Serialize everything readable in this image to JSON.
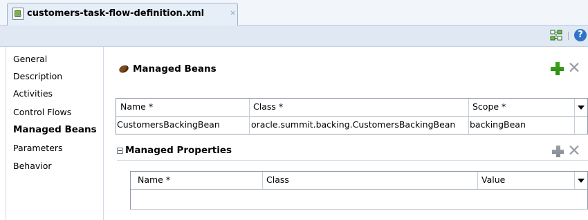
{
  "tab": {
    "title": "customers-task-flow-definition.xml",
    "close": "×"
  },
  "toolbar": {
    "help": "?"
  },
  "nav": {
    "items": [
      {
        "label": "General"
      },
      {
        "label": "Description"
      },
      {
        "label": "Activities"
      },
      {
        "label": "Control Flows"
      },
      {
        "label": "Managed Beans",
        "active": true
      },
      {
        "label": "Parameters"
      },
      {
        "label": "Behavior"
      }
    ]
  },
  "managed_beans": {
    "title": "Managed Beans",
    "columns": [
      "Name *",
      "Class *",
      "Scope *"
    ],
    "rows": [
      {
        "name": "CustomersBackingBean",
        "class": "oracle.summit.backing.CustomersBackingBean",
        "scope": "backingBean"
      }
    ]
  },
  "managed_properties": {
    "title": "Managed Properties",
    "columns": [
      "Name *",
      "Class",
      "Value"
    ]
  }
}
